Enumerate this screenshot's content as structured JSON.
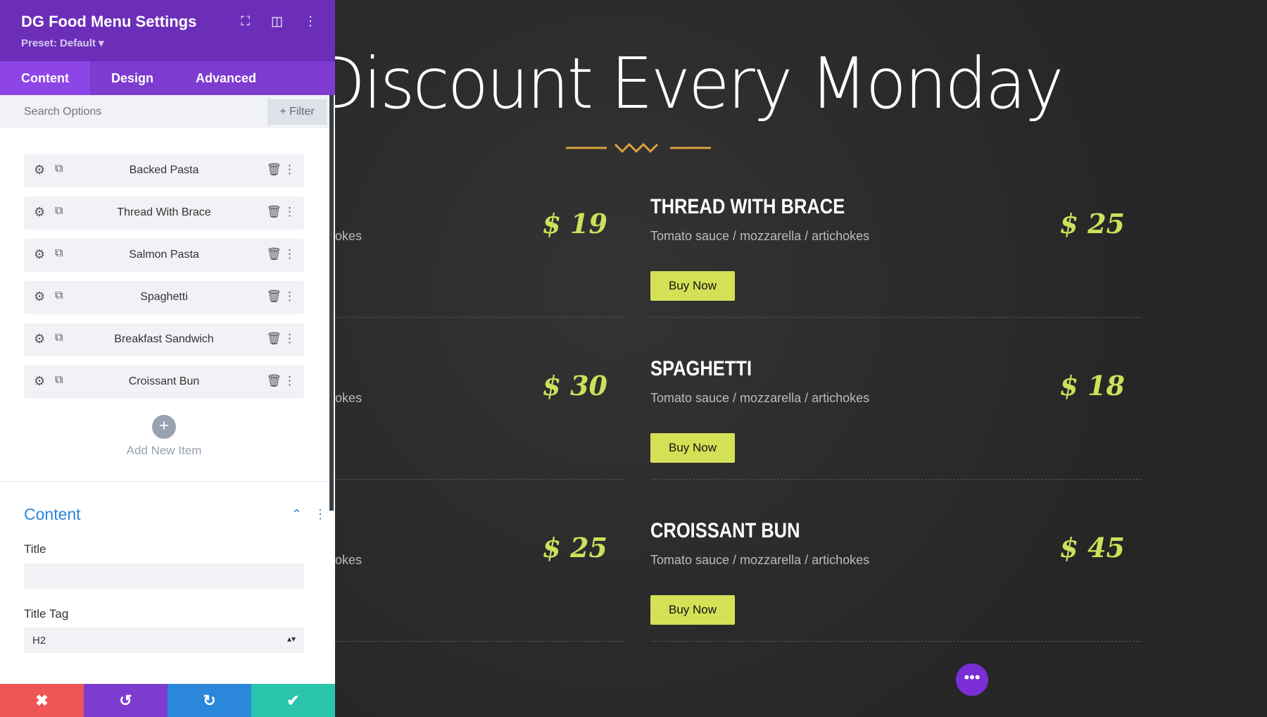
{
  "panel": {
    "title": "DG Food Menu Settings",
    "preset": "Preset: Default ▾",
    "tabs": [
      "Content",
      "Design",
      "Advanced"
    ],
    "search_placeholder": "Search Options",
    "filter": "+ Filter",
    "items": [
      "Backed Pasta",
      "Thread With Brace",
      "Salmon Pasta",
      "Spaghetti",
      "Breakfast Sandwich",
      "Croissant Bun"
    ],
    "add_item": "Add New Item",
    "section": "Content",
    "title_label": "Title",
    "title_value": "",
    "title_tag_label": "Title Tag",
    "title_tag_value": "H2"
  },
  "canvas": {
    "heading": "Discount Every Monday",
    "left": [
      {
        "desc": "okes",
        "price": "$ 19"
      },
      {
        "desc": "okes",
        "price": "$ 30"
      },
      {
        "desc": "okes",
        "price": "$ 25"
      }
    ],
    "right": [
      {
        "title": "THREAD WITH BRACE",
        "desc": "Tomato sauce / mozzarella / artichokes",
        "price": "$ 25",
        "button": "Buy Now"
      },
      {
        "title": "SPAGHETTI",
        "desc": "Tomato sauce / mozzarella / artichokes",
        "price": "$ 18",
        "button": "Buy Now"
      },
      {
        "title": "CROISSANT BUN",
        "desc": "Tomato sauce / mozzarella / artichokes",
        "price": "$ 45",
        "button": "Buy Now"
      }
    ]
  },
  "colors": {
    "header": "#6c2eb9",
    "accent_price": "#cfe05a",
    "buy_button": "#d4e157",
    "cancel": "#ef5555",
    "undo": "#7e3bd0",
    "redo": "#2b87da",
    "save": "#29c4a9"
  }
}
